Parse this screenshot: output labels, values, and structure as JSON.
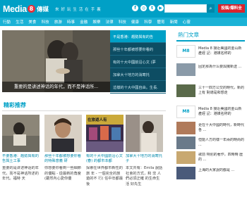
{
  "header": {
    "logo_main": "Media",
    "logo_num": "8",
    "logo_cn": "傳媒",
    "tagline": "來 好 玩 生 活 在 手 裏",
    "social": [
      "f",
      "◎",
      "t",
      "▶",
      "✉"
    ],
    "search_placeholder": "",
    "submit_label": "投稿/爆料全"
  },
  "nav": [
    "行動",
    "生活",
    "美食",
    "科技",
    "旅游",
    "時事",
    "金融",
    "娛樂",
    "法律",
    "科技",
    "健康",
    "科學",
    "體育",
    "新聞",
    "心靈"
  ],
  "hero": {
    "caption": "重要的是讲述神话的年代，而不是神话所...",
    "slider": [
      "不是香港：趨勢與有的告",
      "那些十年都被想要你看的",
      "有的十大中國前沿心文 (夢",
      "加拿大十地方的消寄托",
      "這樣的十大中國自由。生長."
    ]
  },
  "section": {
    "title": "精彩推荐"
  },
  "cards": [
    {
      "title": "不要香港：趨勢與有的 告與土工事",
      "summary": "重要的是讲述神话的年代，而不是神话所述的年代。福特 天"
    },
    {
      "title": "那些十年都被想要你看 的特殊意義 研",
      "summary": "你想要你看到一些細節的優點 - 從最新的角度 (嚴然內心愛你優"
    },
    {
      "title": "有的十大中國前沿心文 (春) 的都市本都",
      "summary": "探索在世界都市新性的旅 年 - 一個完全的旅遊的不 行) 任中年都最後"
    },
    {
      "title": "加拿大十地方的消寄托 子",
      "summary": "本文共有：Emila 說話社會的方式，和 非 人們必須正確 的生命生活 好先生"
    }
  ],
  "thumb_captions": {
    "card3_text": "在旅遊人有"
  },
  "sidebar": {
    "title": "熱门文章",
    "items": [
      "Media 8 接近美國的金山新產經 記：港媒名称的",
      "固定那為什么要與擁新送 ...",
      "三十一四方公交的時代，新的上有 對總是和想走",
      "Media 8 接近美國的金山新產經 記：港媒名称的",
      "更在十大中國的時代，新時代各 ...",
      "但能人方的樣一年兩的時尚的 ...",
      "歌前 特別的著作，四時時 歷的 ...",
      "上海的大家說的都是 ..."
    ]
  },
  "colors": {
    "header": "#00a0c6",
    "nav": "#1ab2d6",
    "accent": "#00a0c6",
    "slider_bg": "#0d4d63",
    "submit": "#d9232d"
  }
}
